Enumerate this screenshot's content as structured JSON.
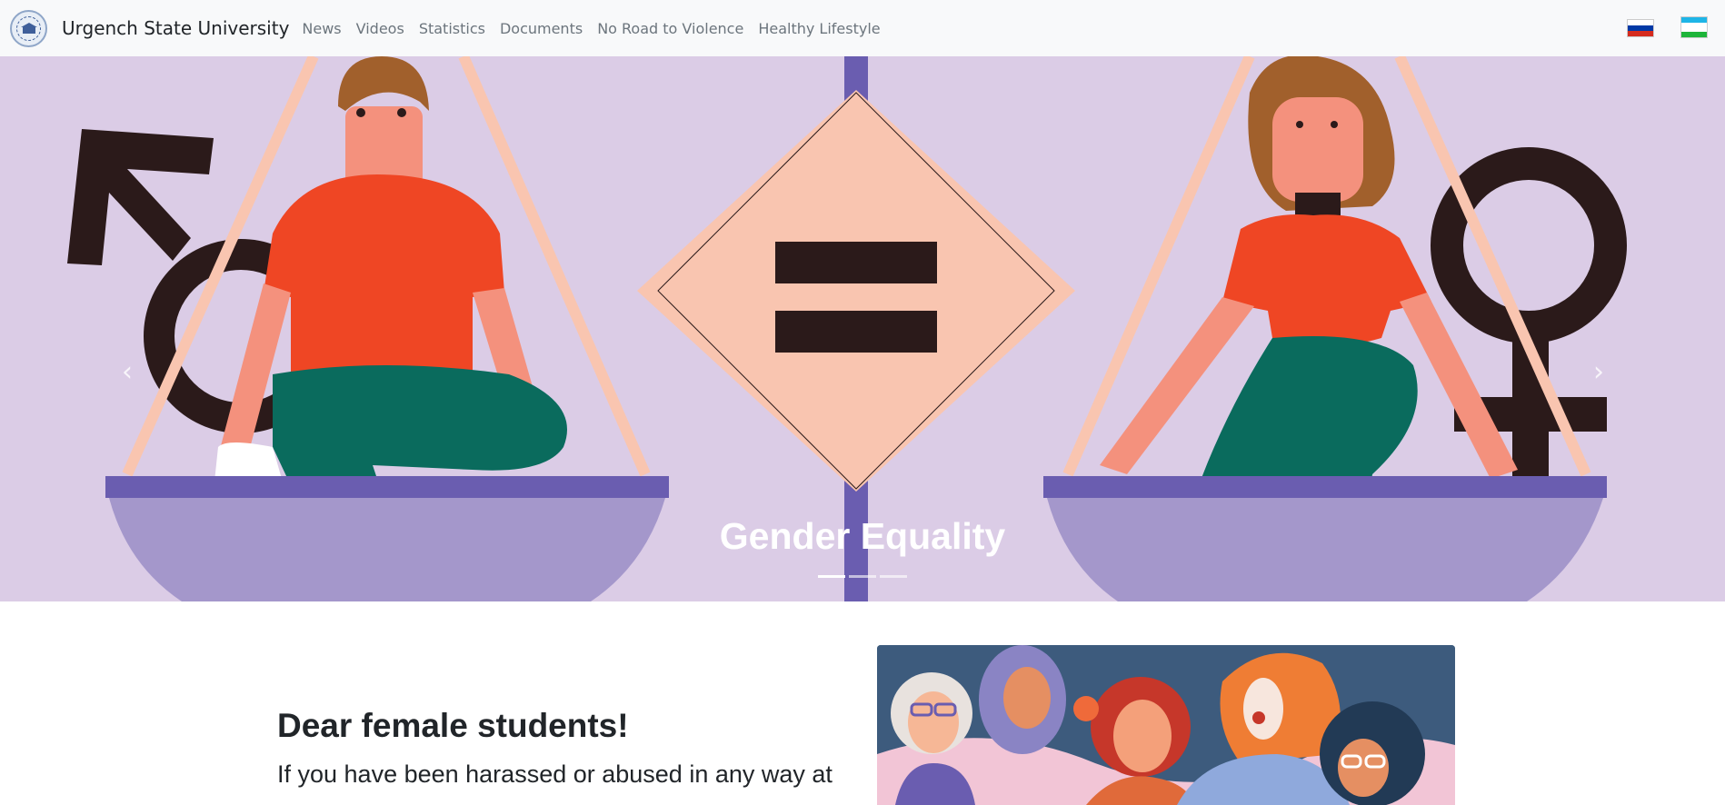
{
  "header": {
    "brand": "Urgench State University",
    "nav": [
      "News",
      "Videos",
      "Statistics",
      "Documents",
      "No Road to Violence",
      "Healthy Lifestyle"
    ],
    "languages": [
      {
        "name": "ru-flag-icon",
        "colors": [
          "#ffffff",
          "#0039a6",
          "#d52b1e"
        ]
      },
      {
        "name": "uz-flag-icon",
        "colors": [
          "#1eb5e7",
          "#ffffff",
          "#1eb53a"
        ]
      }
    ]
  },
  "carousel": {
    "caption": "Gender Equality",
    "slides": 3,
    "active_slide": 1,
    "prev_icon": "chevron-left-icon",
    "next_icon": "chevron-right-icon"
  },
  "main": {
    "heading": "Dear female students!",
    "text": "If you have been harassed or abused in any way at"
  },
  "colors": {
    "hero_bg": "#dbcce6",
    "navbar_bg": "#f8f9fa",
    "accent_orange": "#ef4624",
    "accent_green": "#0a6b5d",
    "scale_purple": "#a497cb"
  }
}
